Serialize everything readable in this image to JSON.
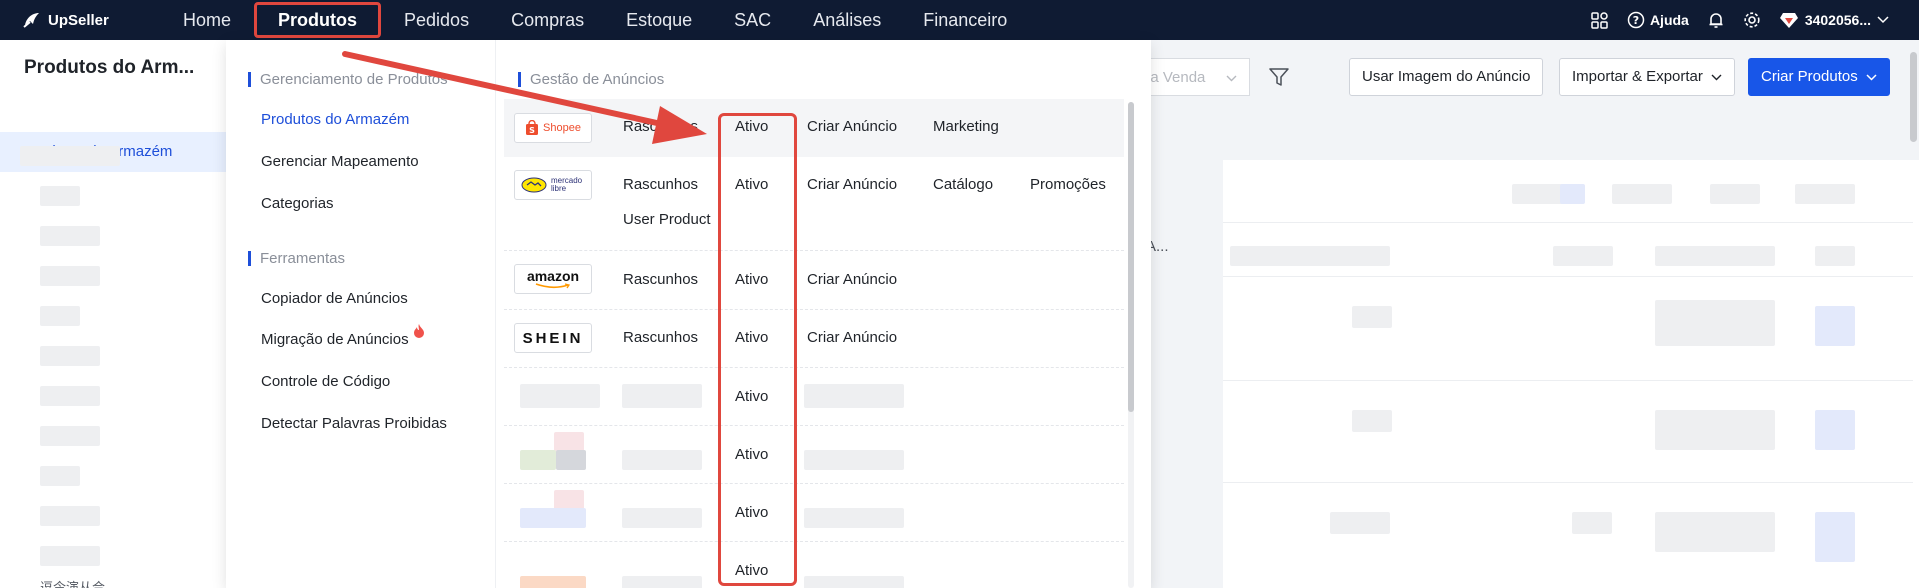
{
  "brand": {
    "name": "UpSeller"
  },
  "nav": {
    "items": [
      {
        "label": "Home",
        "active": false
      },
      {
        "label": "Produtos",
        "active": true
      },
      {
        "label": "Pedidos",
        "active": false
      },
      {
        "label": "Compras",
        "active": false
      },
      {
        "label": "Estoque",
        "active": false
      },
      {
        "label": "SAC",
        "active": false
      },
      {
        "label": "Análises",
        "active": false
      },
      {
        "label": "Financeiro",
        "active": false
      }
    ],
    "help_label": "Ajuda",
    "account_label": "3402056..."
  },
  "sidebar": {
    "title": "Produtos do Arm...",
    "selected_item": "Produtos do Armazém",
    "partial_text": "逗令演从合"
  },
  "toolbar": {
    "select_placeholder": "da Venda",
    "use_image_label": "Usar Imagem do Anúncio",
    "import_export_label": "Importar & Exportar",
    "create_products_label": "Criar Produtos"
  },
  "background": {
    "ellipsis_text": "A..."
  },
  "menu": {
    "product_management": {
      "heading": "Gerenciamento de Produtos",
      "items": [
        "Produtos do Armazém",
        "Gerenciar Mapeamento",
        "Categorias"
      ]
    },
    "tools": {
      "heading": "Ferramentas",
      "items": [
        "Copiador de Anúncios",
        "Migração de Anúncios",
        "Controle de Código",
        "Detectar Palavras Proibidas"
      ]
    },
    "listings": {
      "heading": "Gestão de Anúncios",
      "marketplaces": [
        {
          "logo": "Shopee",
          "links": [
            "Rascunhos",
            "Ativo",
            "Criar Anúncio",
            "Marketing"
          ]
        },
        {
          "logo": "mercado libre",
          "links": [
            "Rascunhos",
            "Ativo",
            "Criar Anúncio",
            "Catálogo",
            "Promoções",
            "User Product"
          ]
        },
        {
          "logo": "amazon",
          "links": [
            "Rascunhos",
            "Ativo",
            "Criar Anúncio"
          ]
        },
        {
          "logo": "SHEIN",
          "links": [
            "Rascunhos",
            "Ativo",
            "Criar Anúncio"
          ]
        }
      ],
      "blurred_active_labels": [
        "Ativo",
        "Ativo",
        "Ativo",
        "Ativo"
      ]
    }
  },
  "colors": {
    "topbar": "#0f1b33",
    "accent": "#1856e8",
    "annotation": "#e0473e"
  }
}
